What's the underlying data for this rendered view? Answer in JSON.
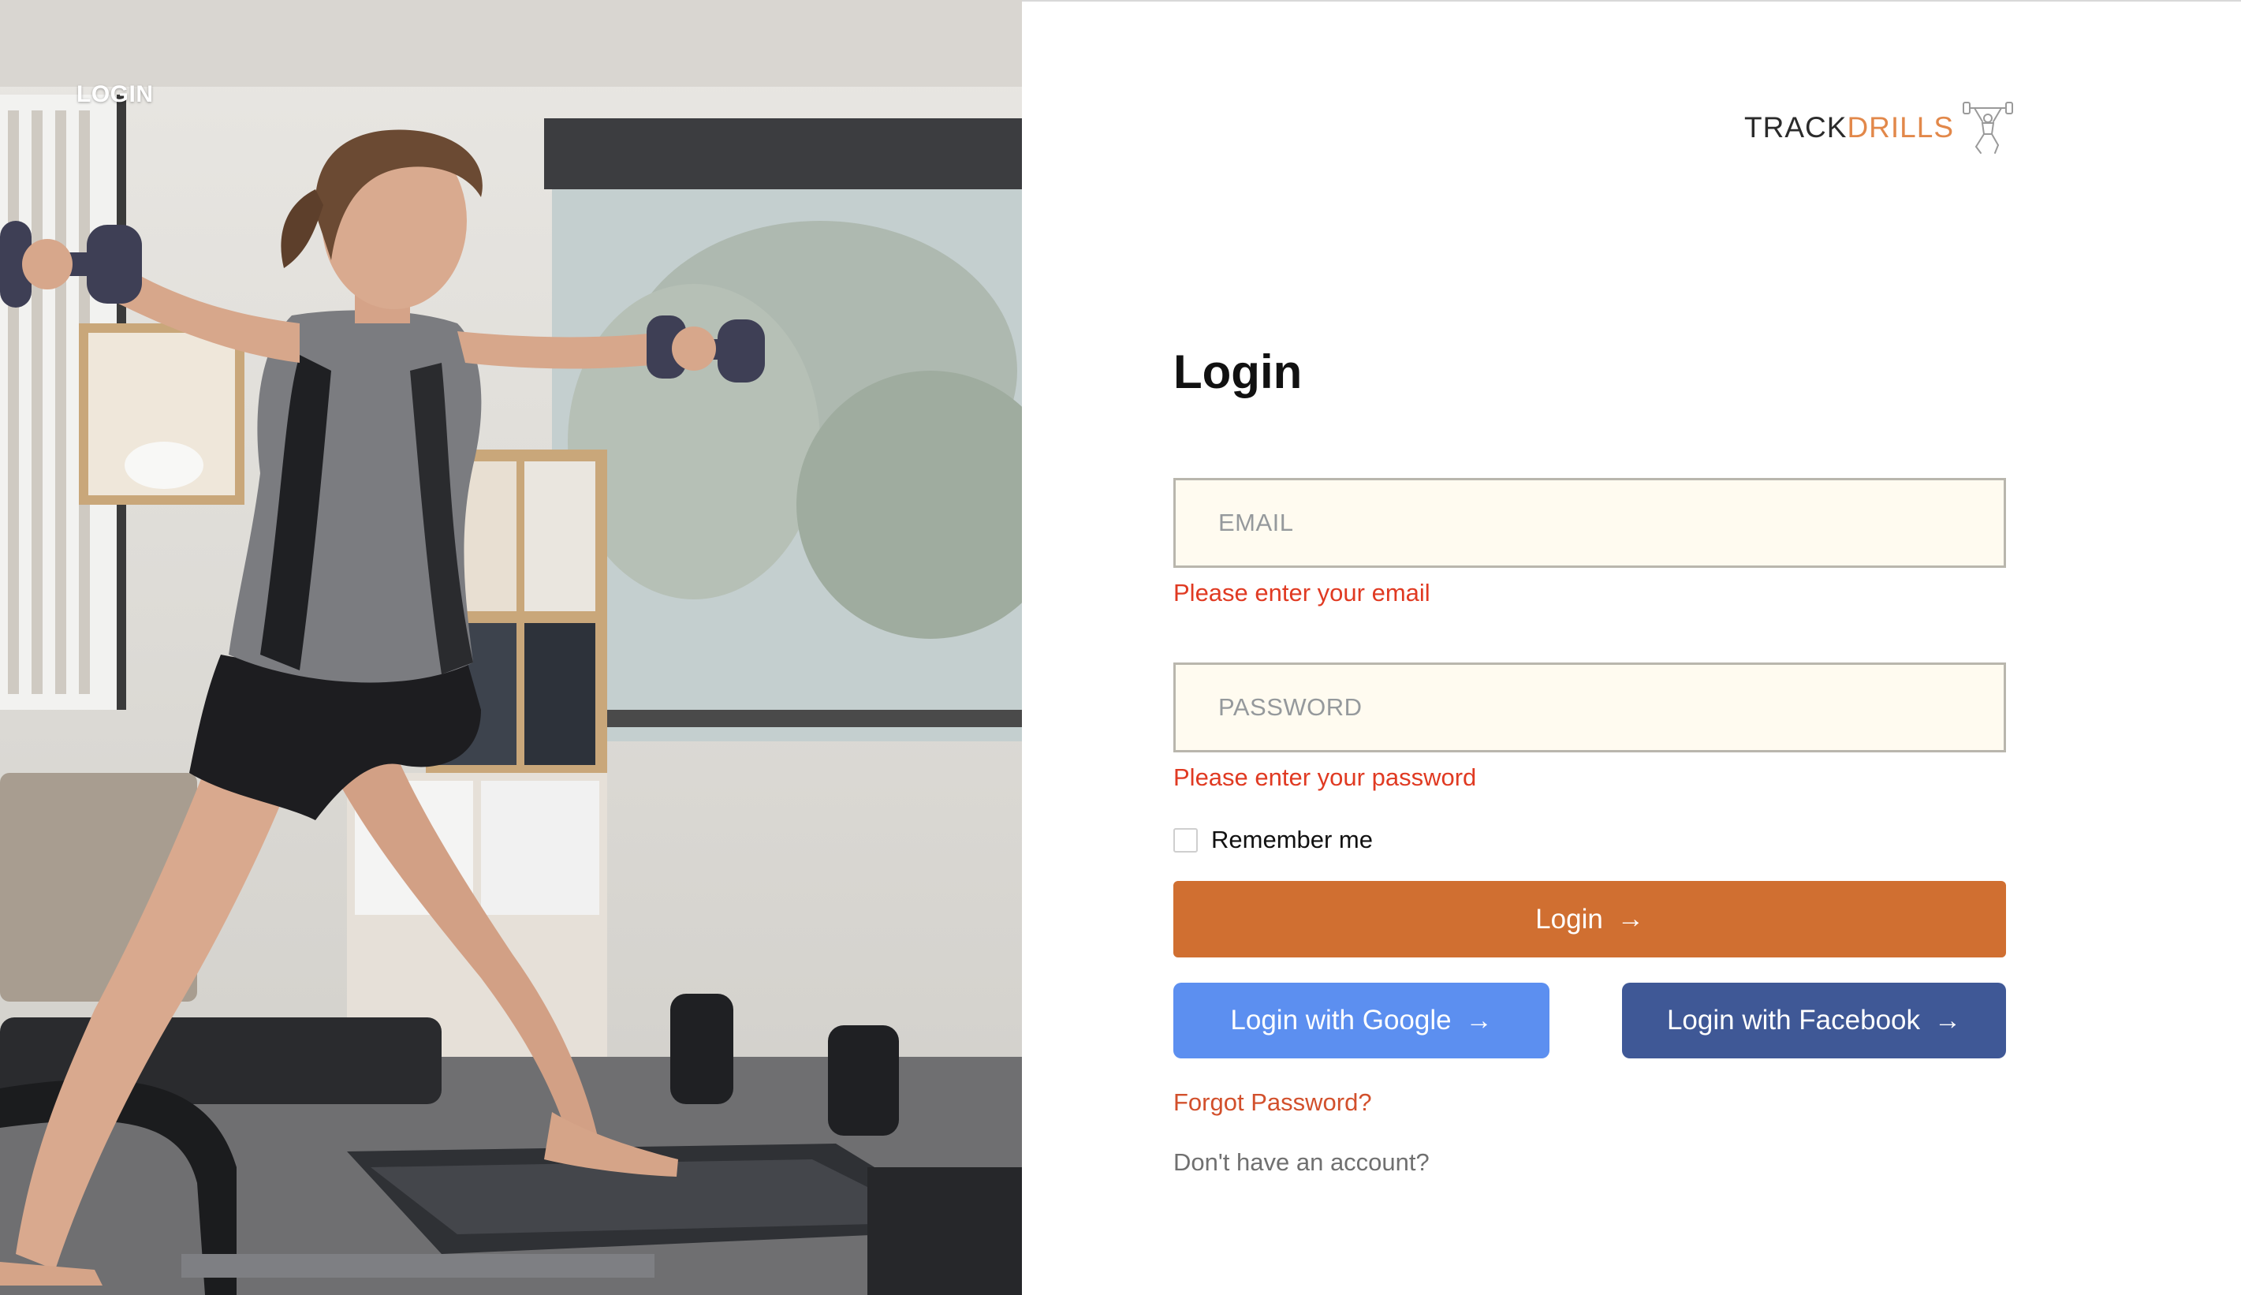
{
  "hero": {
    "label": "LOGIN"
  },
  "brand": {
    "text_primary": "TRACK",
    "text_accent": "DRILLS",
    "accent_color": "#e2884a",
    "icon": "weightlifter-icon"
  },
  "form": {
    "title": "Login",
    "email": {
      "placeholder": "EMAIL",
      "value": "",
      "error": "Please enter your email"
    },
    "password": {
      "placeholder": "PASSWORD",
      "value": "",
      "error": "Please enter your password"
    },
    "remember_label": "Remember me",
    "remember_checked": false,
    "login_label": "Login",
    "google_label": "Login with Google",
    "facebook_label": "Login with Facebook",
    "forgot_label": "Forgot Password?",
    "signup_label": "Don't have an account?"
  },
  "colors": {
    "login_button": "#d06f31",
    "google_button": "#5c8ff0",
    "facebook_button": "#3f5896",
    "error_text": "#e03a22",
    "field_background": "#fffbf0"
  }
}
